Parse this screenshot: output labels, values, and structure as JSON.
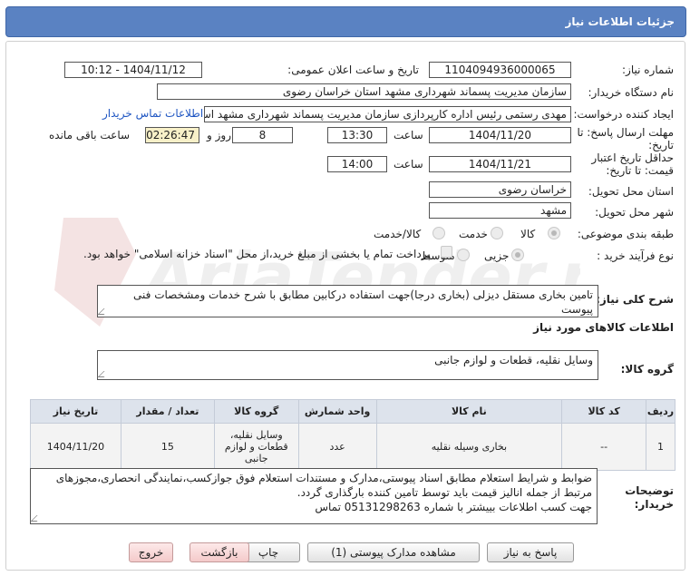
{
  "header": {
    "title": "جزئیات اطلاعات نیاز"
  },
  "form": {
    "need_number_label": "شماره نیاز:",
    "need_number": "1104094936000065",
    "announce_label": "تاریخ و ساعت اعلان عمومی:",
    "announce_value": "1404/11/12 - 10:12",
    "buyer_org_label": "نام دستگاه خریدار:",
    "buyer_org": "سازمان مدیریت پسماند شهرداری مشهد استان خراسان رضوی",
    "creator_label": "ایجاد کننده درخواست:",
    "creator": "مهدی رستمی رئیس اداره کارپردازی سازمان مدیریت پسماند شهرداری مشهد استان",
    "contact_link": "اطلاعات تماس خریدار",
    "deadline_label_1": "مهلت ارسال پاسخ: تا",
    "deadline_label_2": "تاریخ:",
    "deadline_date": "1404/11/20",
    "time_label": "ساعت",
    "deadline_time": "13:30",
    "days_value": "8",
    "days_label": "روز و",
    "remaining_time": "02:26:47",
    "remaining_label": "ساعت باقی مانده",
    "validity_label_1": "حداقل تاریخ اعتبار",
    "validity_label_2": "قیمت: تا تاریخ:",
    "validity_date": "1404/11/21",
    "validity_time": "14:00",
    "province_label": "استان محل تحویل:",
    "province": "خراسان رضوی",
    "city_label": "شهر محل تحویل:",
    "city": "مشهد",
    "category_label": "طبقه بندی موضوعی:",
    "category_options": [
      "کالا",
      "خدمت",
      "کالا/خدمت"
    ],
    "category_selected": "کالا",
    "process_label": "نوع فرآیند خرید :",
    "process_options": [
      "جزیی",
      "متوسط"
    ],
    "process_selected": "جزیی",
    "payment_note": "پرداخت تمام یا بخشی از مبلغ خرید،از محل \"اسناد خزانه اسلامی\" خواهد بود."
  },
  "description": {
    "label": "شرح کلی نیاز:",
    "text": "تامین بخاری مستقل دیزلی (بخاری درجا)جهت استفاده درکابین مطابق با شرح خدمات ومشخصات فنی پیوست"
  },
  "goods": {
    "section_title": "اطلاعات کالاهای مورد نیاز",
    "group_label": "گروه کالا:",
    "group_value": "وسایل نقلیه، قطعات و لوازم جانبی"
  },
  "table": {
    "headers": [
      "ردیف",
      "کد کالا",
      "نام کالا",
      "واحد شمارش",
      "گروه کالا",
      "تعداد / مقدار",
      "تاریخ نیاز"
    ],
    "rows": [
      {
        "row": "1",
        "code": "--",
        "name": "بخاری وسیله نقلیه",
        "unit": "عدد",
        "group": "وسایل نقلیه، قطعات و لوازم جانبی",
        "qty": "15",
        "date": "1404/11/20"
      }
    ]
  },
  "notes": {
    "label_1": "توضیحات",
    "label_2": "خریدار:",
    "line1": "ضوابط و شرایط استعلام مطابق اسناد پیوستی،مدارک و مستندات استعلام فوق جوازکسب،نمایندگی انحصاری،مجوزهای",
    "line2": "مرتبط از جمله انالیز قیمت باید توسط تامین کننده بارگذاری گردد.",
    "line3": "جهت کسب اطلاعات بییشتر با شماره 05131298263 تماس"
  },
  "buttons": {
    "reply": "پاسخ به نیاز",
    "view_docs": "مشاهده مدارک پیوستی (1)",
    "print": "چاپ",
    "back": "بازگشت",
    "exit": "خروج"
  },
  "watermark": {
    "text": "AriaTender.net"
  },
  "colors": {
    "header_bg": "#5a82c2",
    "link": "#1f56c2",
    "exit_btn": "#f4caca",
    "timer_bg": "#f7f0c8"
  }
}
